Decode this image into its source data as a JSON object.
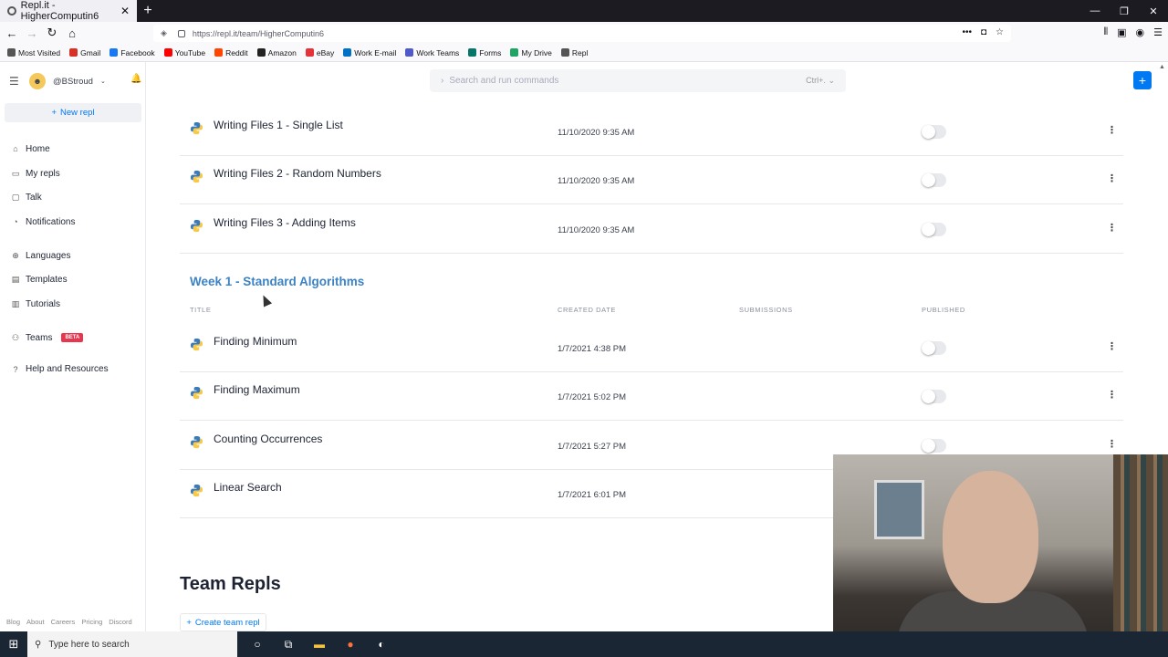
{
  "browser": {
    "tab_title": "Repl.it - HigherComputin6",
    "new_tab": "+",
    "url": "https://repl.it/team/HigherComputin6",
    "bookmarks": [
      "Most Visited",
      "Gmail",
      "Facebook",
      "YouTube",
      "Reddit",
      "Amazon",
      "eBay",
      "Work E-mail",
      "Work Teams",
      "Forms",
      "My Drive",
      "Repl"
    ],
    "bookmark_colors": [
      "#555555",
      "#d93025",
      "#1877f2",
      "#ff0000",
      "#ff4500",
      "#222222",
      "#e53238",
      "#0072c6",
      "#5059c9",
      "#077568",
      "#1fa463",
      "#555555"
    ]
  },
  "sidebar": {
    "username": "@BStroud",
    "new_repl": "New repl",
    "items": [
      {
        "label": "Home",
        "icon": "home-icon",
        "glyph": "⌂"
      },
      {
        "label": "My repls",
        "icon": "folder-icon",
        "glyph": "▭"
      },
      {
        "label": "Talk",
        "icon": "chat-icon",
        "glyph": "▢"
      },
      {
        "label": "Notifications",
        "icon": "bell-icon",
        "glyph": "◔"
      },
      {
        "label": "Languages",
        "icon": "globe-icon",
        "glyph": "⊕"
      },
      {
        "label": "Templates",
        "icon": "template-icon",
        "glyph": "▤"
      },
      {
        "label": "Tutorials",
        "icon": "book-icon",
        "glyph": "▥"
      },
      {
        "label": "Teams",
        "icon": "people-icon",
        "glyph": "⚇"
      },
      {
        "label": "Help and Resources",
        "icon": "help-icon",
        "glyph": "?"
      }
    ],
    "beta_badge": "BETA",
    "footer_links": [
      "Blog",
      "About",
      "Careers",
      "Pricing",
      "Discord"
    ]
  },
  "topbar": {
    "search_placeholder": "Search and run commands",
    "search_shortcut": "Ctrl+."
  },
  "previous_rows": [
    {
      "title": "Writing Files 1 - Single List",
      "created": "11/10/2020 9:35 AM"
    },
    {
      "title": "Writing Files 2 - Random Numbers",
      "created": "11/10/2020 9:35 AM"
    },
    {
      "title": "Writing Files 3 - Adding Items",
      "created": "11/10/2020 9:35 AM"
    }
  ],
  "section": {
    "title": "Week 1 - Standard Algorithms",
    "columns": {
      "title": "TITLE",
      "created": "CREATED DATE",
      "submissions": "SUBMISSIONS",
      "published": "PUBLISHED"
    },
    "rows": [
      {
        "title": "Finding Minimum",
        "created": "1/7/2021 4:38 PM"
      },
      {
        "title": "Finding Maximum",
        "created": "1/7/2021 5:02 PM"
      },
      {
        "title": "Counting Occurrences",
        "created": "1/7/2021 5:27 PM"
      },
      {
        "title": "Linear Search",
        "created": "1/7/2021 6:01 PM"
      }
    ]
  },
  "team_repls": {
    "title": "Team Repls",
    "create_button": "Create team repl"
  },
  "taskbar": {
    "search_placeholder": "Type here to search"
  }
}
